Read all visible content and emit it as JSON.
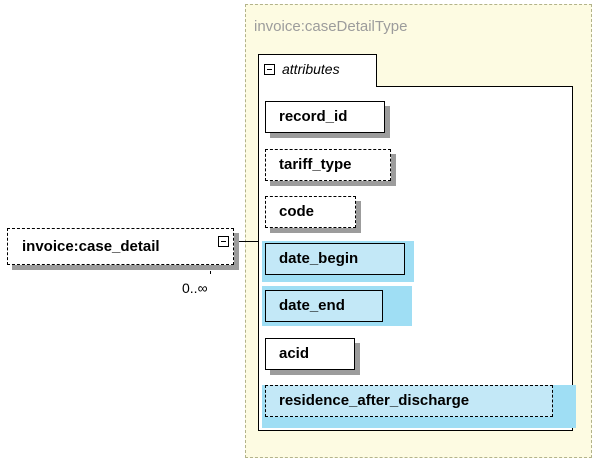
{
  "type": {
    "name": "invoice:caseDetailType",
    "tab_label": "attributes"
  },
  "element": {
    "name": "invoice:case_detail",
    "occurrence": "0..∞"
  },
  "attributes": [
    {
      "name": "record_id",
      "use": "required",
      "highlighted": false
    },
    {
      "name": "tariff_type",
      "use": "optional",
      "highlighted": false
    },
    {
      "name": "code",
      "use": "optional",
      "highlighted": false
    },
    {
      "name": "date_begin",
      "use": "required",
      "highlighted": true
    },
    {
      "name": "date_end",
      "use": "required",
      "highlighted": true
    },
    {
      "name": "acid",
      "use": "required",
      "highlighted": false
    },
    {
      "name": "residence_after_discharge",
      "use": "optional",
      "highlighted": true
    }
  ],
  "colors": {
    "type_background": "#fdfbe2",
    "highlight": "#9fdef4",
    "highlight_fill": "#c3e8f7",
    "shadow": "#9c9c9c",
    "title_text": "#9c9c9c"
  }
}
